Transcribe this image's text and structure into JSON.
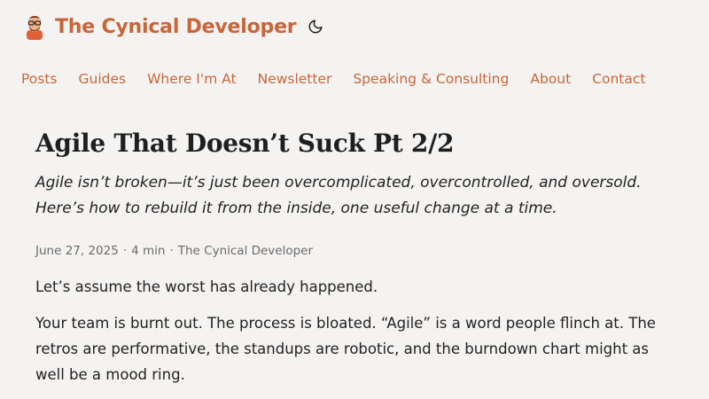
{
  "header": {
    "site_title": "The Cynical Developer",
    "avatar_icon": "developer-avatar-icon",
    "theme_toggle_icon": "moon-icon"
  },
  "nav": {
    "items": [
      {
        "label": "Posts"
      },
      {
        "label": "Guides"
      },
      {
        "label": "Where I'm At"
      },
      {
        "label": "Newsletter"
      },
      {
        "label": "Speaking & Consulting"
      },
      {
        "label": "About"
      },
      {
        "label": "Contact"
      }
    ]
  },
  "post": {
    "title": "Agile That Doesn’t Suck Pt 2/2",
    "subtitle": "Agile isn’t broken—it’s just been overcomplicated, overcontrolled, and oversold. Here’s how to rebuild it from the inside, one useful change at a time.",
    "meta": {
      "date": "June 27, 2025",
      "separator": "·",
      "read_time": "4 min",
      "author": "The Cynical Developer"
    },
    "paragraphs": [
      "Let’s assume the worst has already happened.",
      "Your team is burnt out. The process is bloated. “Agile” is a word people flinch at. The retros are performative, the standups are robotic, and the burndown chart might as well be a mood ring."
    ]
  },
  "colors": {
    "accent": "#c8653a",
    "background": "#f5f3f1",
    "text": "#222222",
    "meta": "#6b6b6b"
  }
}
